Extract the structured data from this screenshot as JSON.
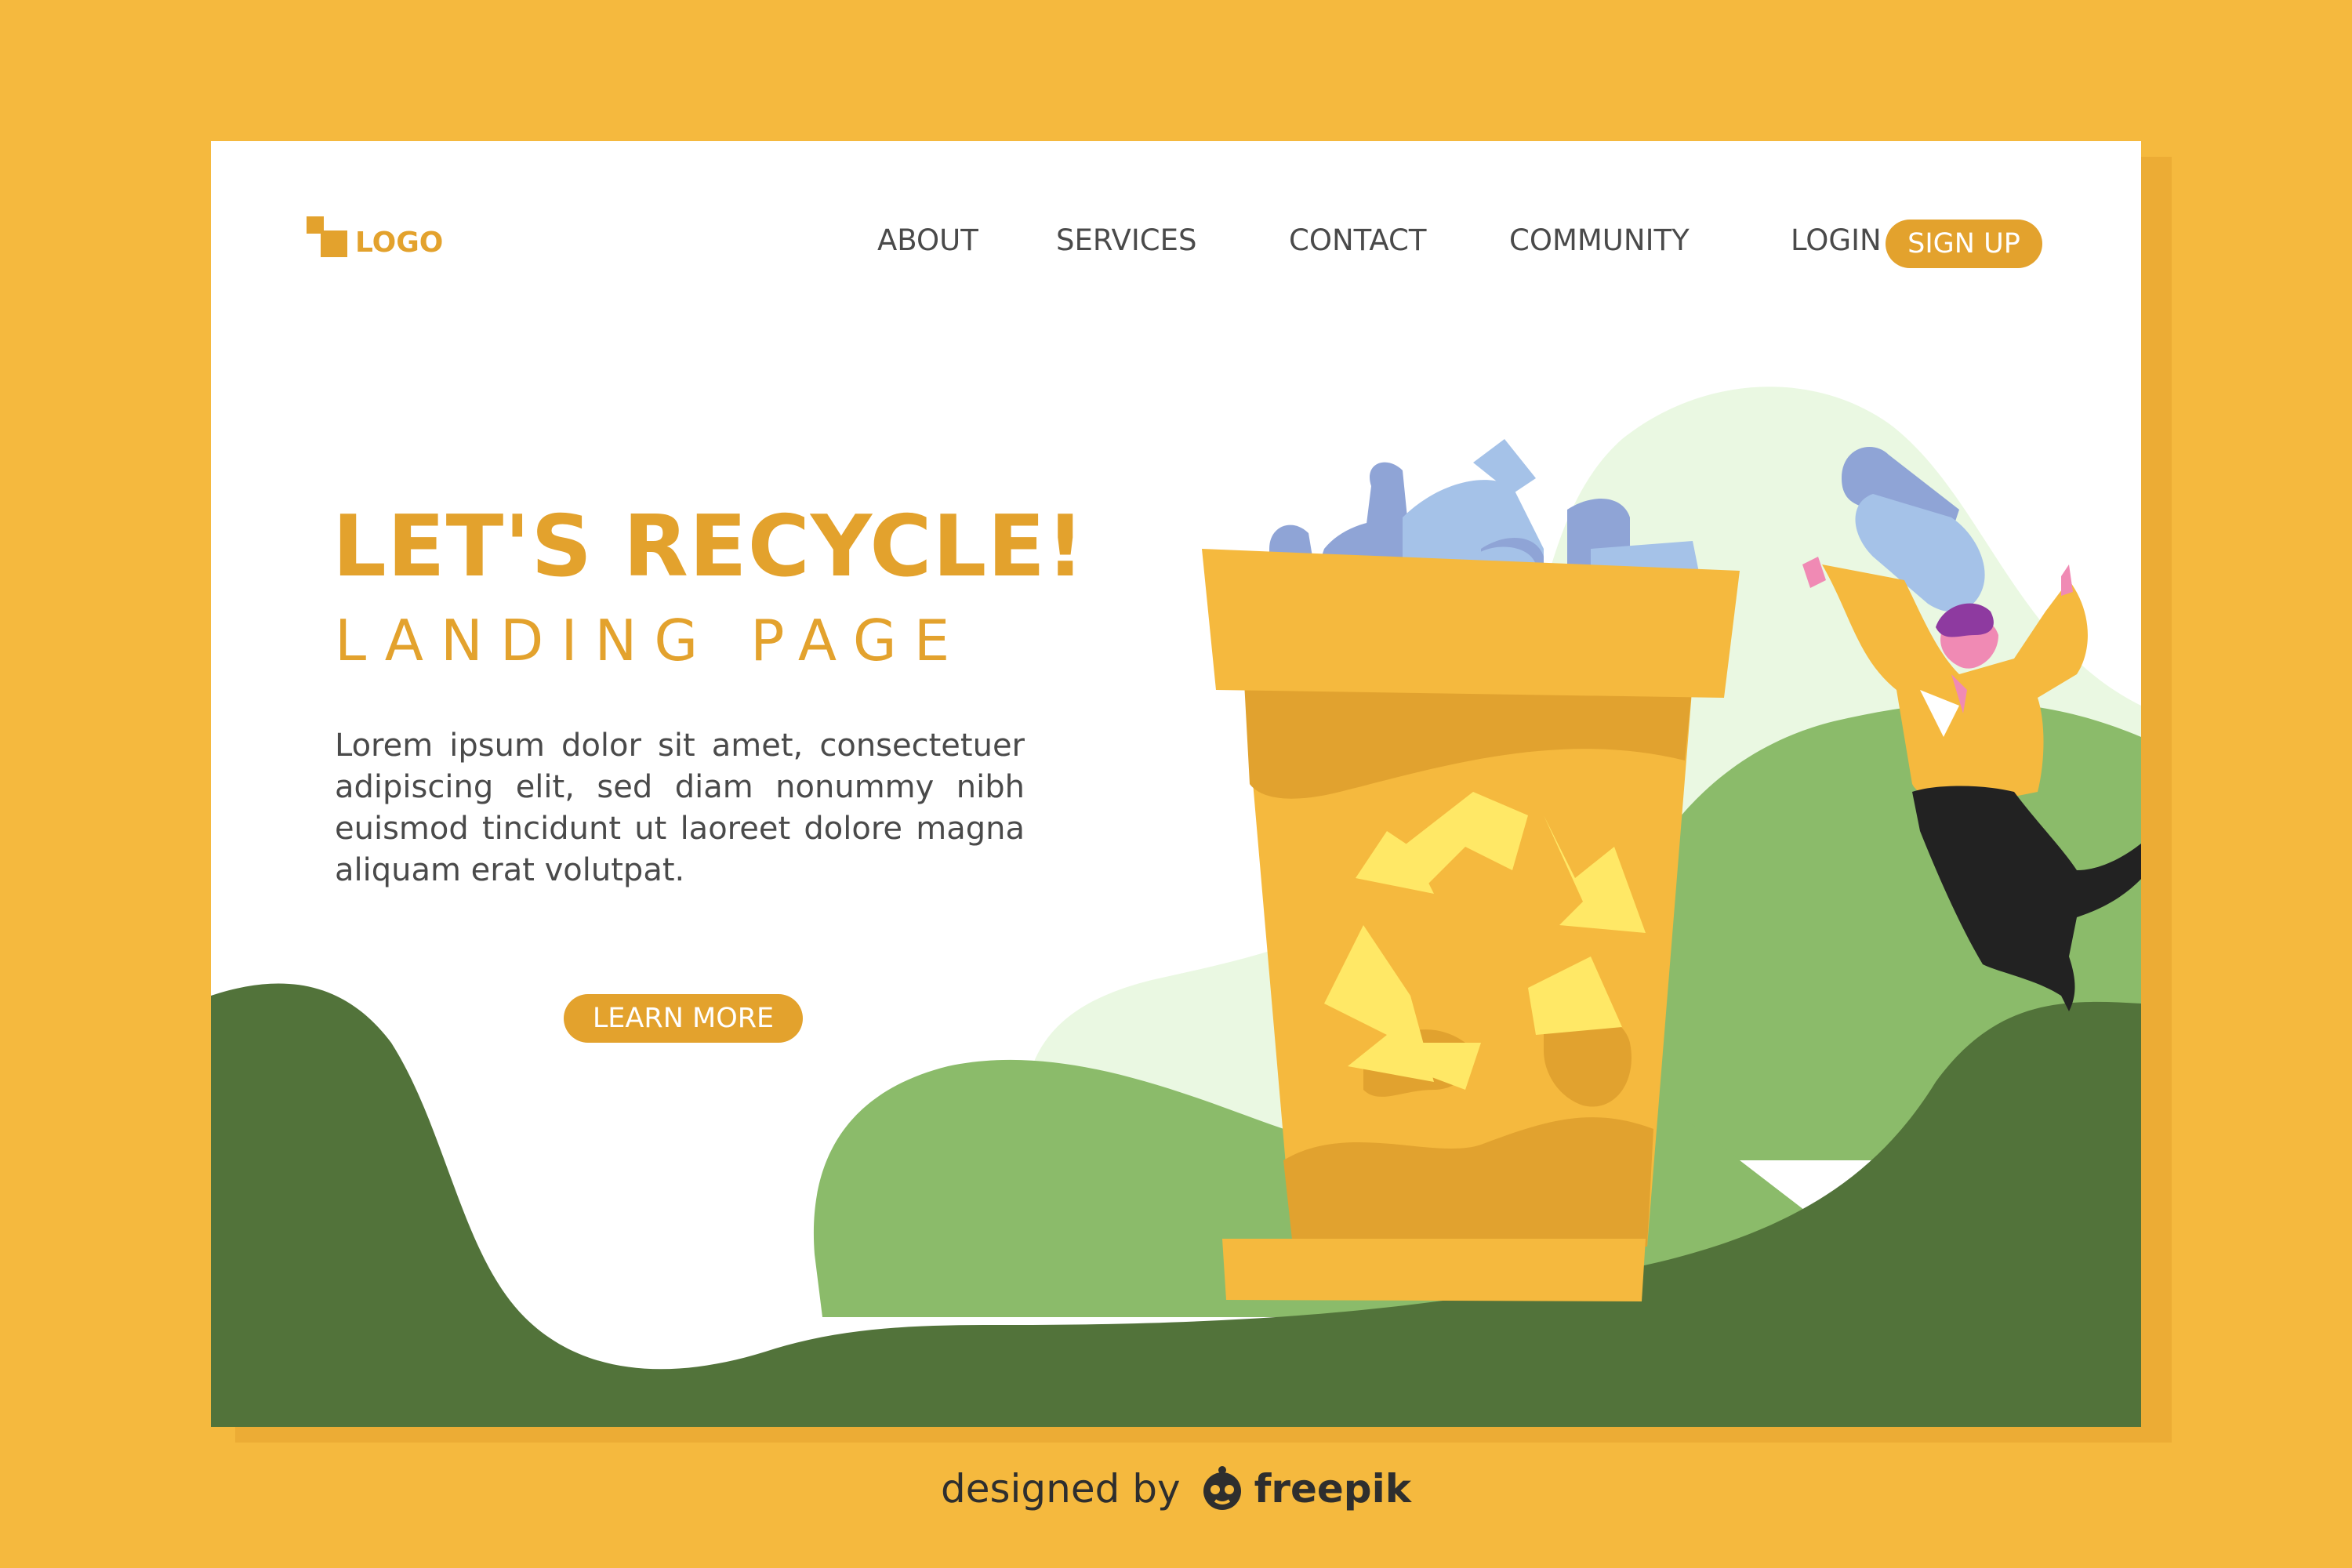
{
  "header": {
    "logo_text": "LOGO",
    "nav": {
      "about": "ABOUT",
      "services": "SERVICES",
      "contact": "CONTACT",
      "community": "COMMUNITY",
      "login": "LOGIN"
    },
    "signup_label": "SIGN UP"
  },
  "hero": {
    "title": "LET'S RECYCLE!",
    "subtitle": "LANDING PAGE",
    "body": "Lorem ipsum dolor sit amet, consectetuer adipiscing elit, sed diam nonummy nibh euismod tincidunt ut laoreet dolore magna aliquam erat volutpat.",
    "cta_label": "LEARN MORE"
  },
  "footer": {
    "designed_by": "designed by",
    "brand": "freepik"
  },
  "colors": {
    "background": "#F5B93E",
    "accent": "#E3A22D",
    "dark_green": "#52733A",
    "light_green": "#8BBB6A",
    "pale_green": "#EAF8E2",
    "bin_yellow": "#F5B93E",
    "bin_shade": "#E1A22F",
    "recycle_symbol": "#FFE866",
    "bottle_blue": "#A5C2E8"
  },
  "icons": [
    "logo-mark",
    "recycle-symbol-icon",
    "freepik-icon"
  ]
}
